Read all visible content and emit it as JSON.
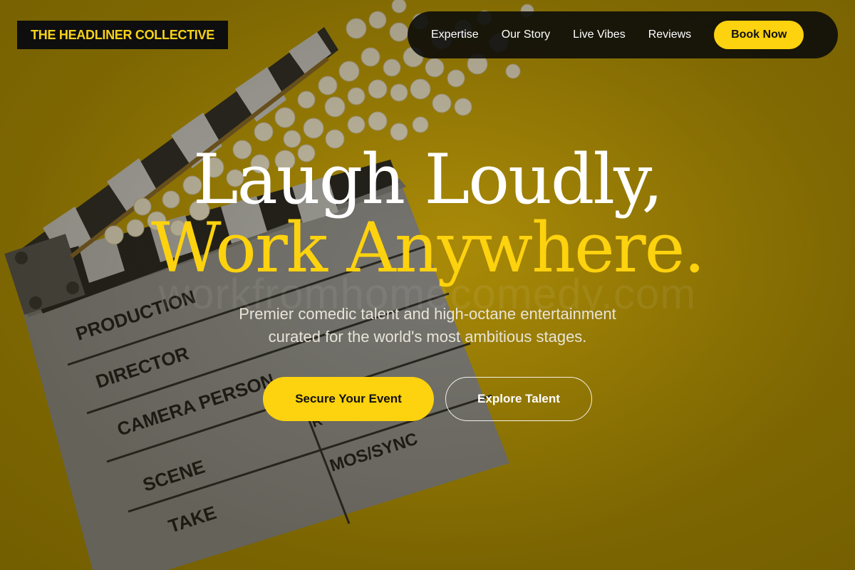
{
  "brand": {
    "logo_text": "THE HEADLINER COLLECTIVE"
  },
  "nav": {
    "links": [
      "Expertise",
      "Our Story",
      "Live Vibes",
      "Reviews"
    ],
    "cta_label": "Book Now"
  },
  "hero": {
    "headline_line1": "Laugh Loudly,",
    "headline_line2": "Work Anywhere.",
    "watermark": "workfromhomecomedy.com",
    "subtitle_line1": "Premier comedic talent and high-octane entertainment",
    "subtitle_line2": "curated for the world's most ambitious stages.",
    "primary_button": "Secure Your Event",
    "secondary_button": "Explore Talent"
  },
  "clapperboard": {
    "labels": [
      "PRODUCTION",
      "DIRECTOR",
      "CAMERA PERSON",
      "SCENE",
      "TAKE",
      "MOS/SYNC",
      "R"
    ]
  },
  "colors": {
    "accent": "#fdd20e",
    "background": "#c7a200",
    "nav_background": "#0c0c0a",
    "logo_background": "#0e0e0e"
  }
}
